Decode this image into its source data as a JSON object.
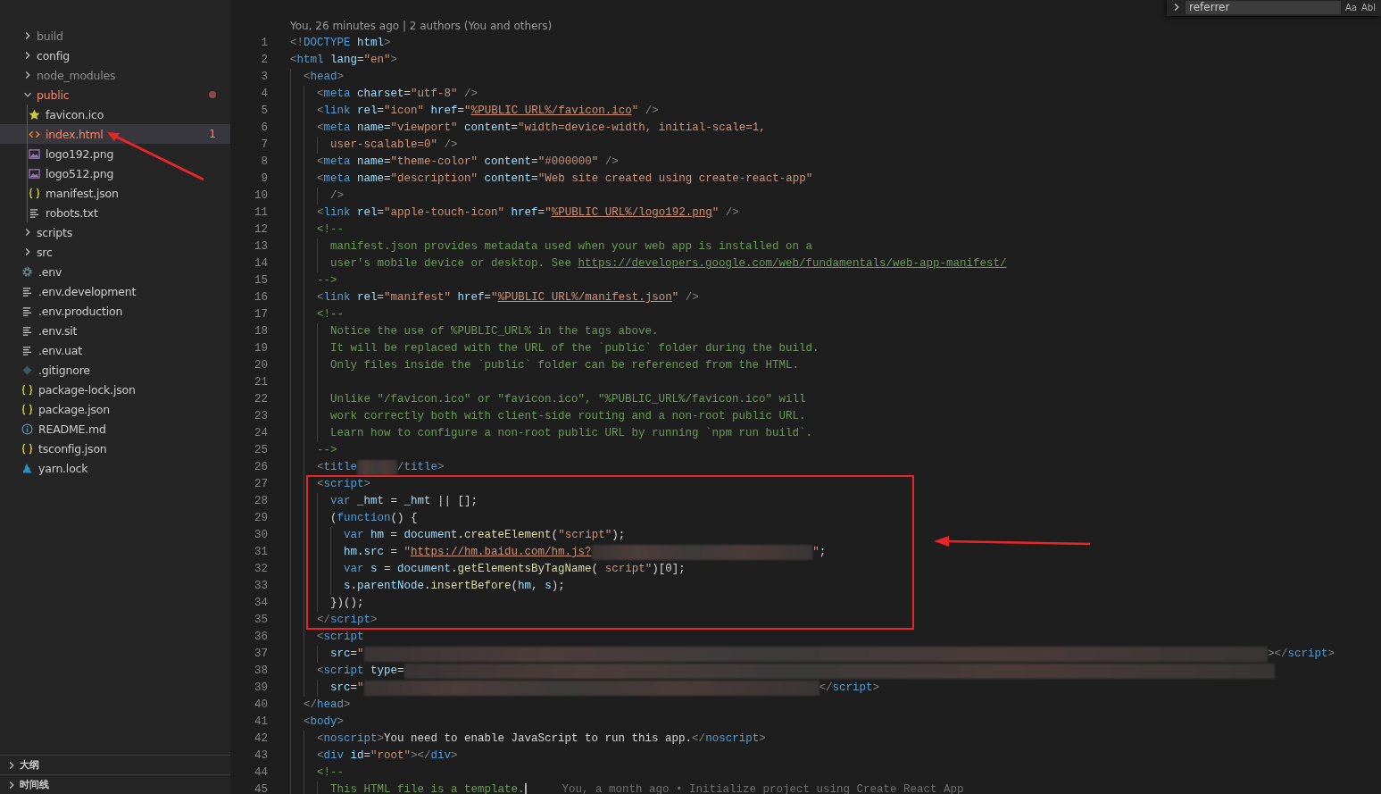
{
  "explorer": {
    "items": [
      {
        "kind": "folder",
        "name": "build",
        "expanded": false,
        "ignored": true,
        "modified": false
      },
      {
        "kind": "folder",
        "name": "config",
        "expanded": false,
        "ignored": false,
        "modified": false
      },
      {
        "kind": "folder",
        "name": "node_modules",
        "expanded": false,
        "ignored": true,
        "modified": false
      },
      {
        "kind": "folder",
        "name": "public",
        "expanded": true,
        "ignored": false,
        "modified": true,
        "children": [
          {
            "kind": "favicon",
            "name": "favicon.ico",
            "selected": false,
            "modified": false
          },
          {
            "kind": "html",
            "name": "index.html",
            "selected": true,
            "modified": true,
            "badge": "1",
            "arrow": true
          },
          {
            "kind": "image",
            "name": "logo192.png",
            "selected": false,
            "modified": false
          },
          {
            "kind": "image",
            "name": "logo512.png",
            "selected": false,
            "modified": false
          },
          {
            "kind": "json",
            "name": "manifest.json",
            "selected": false,
            "modified": false
          },
          {
            "kind": "text",
            "name": "robots.txt",
            "selected": false,
            "modified": false
          }
        ]
      },
      {
        "kind": "folder",
        "name": "scripts",
        "expanded": false,
        "ignored": false,
        "modified": false
      },
      {
        "kind": "folder",
        "name": "src",
        "expanded": false,
        "ignored": false,
        "modified": false
      },
      {
        "kind": "env",
        "name": ".env",
        "selected": false,
        "modified": false
      },
      {
        "kind": "text",
        "name": ".env.development",
        "selected": false,
        "modified": false
      },
      {
        "kind": "text",
        "name": ".env.production",
        "selected": false,
        "modified": false
      },
      {
        "kind": "text",
        "name": ".env.sit",
        "selected": false,
        "modified": false
      },
      {
        "kind": "text",
        "name": ".env.uat",
        "selected": false,
        "modified": false
      },
      {
        "kind": "gitignore",
        "name": ".gitignore",
        "selected": false,
        "modified": false
      },
      {
        "kind": "json",
        "name": "package-lock.json",
        "selected": false,
        "modified": false
      },
      {
        "kind": "json",
        "name": "package.json",
        "selected": false,
        "modified": false
      },
      {
        "kind": "markdown",
        "name": "README.md",
        "selected": false,
        "modified": false
      },
      {
        "kind": "json",
        "name": "tsconfig.json",
        "selected": false,
        "modified": false
      },
      {
        "kind": "yarn",
        "name": "yarn.lock",
        "selected": false,
        "modified": false
      }
    ]
  },
  "panels": [
    {
      "title": "大纲",
      "expanded": false
    },
    {
      "title": "时间线",
      "expanded": false
    }
  ],
  "find_widget": {
    "value": "referrer",
    "options": [
      "Aa",
      "Abl"
    ]
  },
  "editor": {
    "blame_header": "You, 26 minutes ago | 2 authors (You and others)",
    "blocks": [
      {
        "kind": "plain",
        "lines": [
          {
            "number": "1",
            "tokens": [
              {
                "kind": "punct",
                "text": "<!"
              },
              {
                "kind": "tag",
                "text": "DOCTYPE"
              },
              {
                "kind": "attr",
                "text": " html"
              },
              {
                "kind": "punct",
                "text": ">"
              }
            ]
          },
          {
            "number": "2",
            "tokens": [
              {
                "kind": "punct",
                "text": "<"
              },
              {
                "kind": "tag",
                "text": "html"
              },
              {
                "kind": "attr",
                "text": " lang"
              },
              {
                "kind": "text",
                "text": "="
              },
              {
                "kind": "string",
                "text": "\"en\""
              },
              {
                "kind": "punct",
                "text": ">"
              }
            ]
          },
          {
            "number": "3",
            "tokens": [
              {
                "kind": "indent"
              },
              {
                "kind": "punct",
                "text": "<"
              },
              {
                "kind": "tag",
                "text": "head"
              },
              {
                "kind": "punct",
                "text": ">"
              }
            ]
          },
          {
            "number": "4",
            "tokens": [
              {
                "kind": "indent"
              },
              {
                "kind": "indent"
              },
              {
                "kind": "punct",
                "text": "<"
              },
              {
                "kind": "tag",
                "text": "meta"
              },
              {
                "kind": "attr",
                "text": " charset"
              },
              {
                "kind": "text",
                "text": "="
              },
              {
                "kind": "string",
                "text": "\"utf-8\""
              },
              {
                "kind": "punct",
                "text": " />"
              }
            ]
          },
          {
            "number": "5",
            "tokens": [
              {
                "kind": "indent"
              },
              {
                "kind": "indent"
              },
              {
                "kind": "punct",
                "text": "<"
              },
              {
                "kind": "tag",
                "text": "link"
              },
              {
                "kind": "attr",
                "text": " rel"
              },
              {
                "kind": "text",
                "text": "="
              },
              {
                "kind": "string",
                "text": "\"icon\""
              },
              {
                "kind": "attr",
                "text": " href"
              },
              {
                "kind": "text",
                "text": "="
              },
              {
                "kind": "string",
                "text": "\""
              },
              {
                "kind": "string-link",
                "text": "%PUBLIC_URL%/favicon.ico"
              },
              {
                "kind": "string",
                "text": "\""
              },
              {
                "kind": "punct",
                "text": " />"
              }
            ]
          },
          {
            "number": "6",
            "tokens": [
              {
                "kind": "indent"
              },
              {
                "kind": "indent"
              },
              {
                "kind": "punct",
                "text": "<"
              },
              {
                "kind": "tag",
                "text": "meta"
              },
              {
                "kind": "attr",
                "text": " name"
              },
              {
                "kind": "text",
                "text": "="
              },
              {
                "kind": "string",
                "text": "\"viewport\""
              },
              {
                "kind": "attr",
                "text": " content"
              },
              {
                "kind": "text",
                "text": "="
              },
              {
                "kind": "string",
                "text": "\"width=device-width, initial-scale=1,"
              }
            ]
          },
          {
            "number": "7",
            "tokens": [
              {
                "kind": "indent"
              },
              {
                "kind": "indent"
              },
              {
                "kind": "indent"
              },
              {
                "kind": "string",
                "text": "user-scalable=0\""
              },
              {
                "kind": "punct",
                "text": " />"
              }
            ]
          },
          {
            "number": "8",
            "tokens": [
              {
                "kind": "indent"
              },
              {
                "kind": "indent"
              },
              {
                "kind": "punct",
                "text": "<"
              },
              {
                "kind": "tag",
                "text": "meta"
              },
              {
                "kind": "attr",
                "text": " name"
              },
              {
                "kind": "text",
                "text": "="
              },
              {
                "kind": "string",
                "text": "\"theme-color\""
              },
              {
                "kind": "attr",
                "text": " content"
              },
              {
                "kind": "text",
                "text": "="
              },
              {
                "kind": "string",
                "text": "\"#000000\""
              },
              {
                "kind": "punct",
                "text": " />"
              }
            ]
          },
          {
            "number": "9",
            "tokens": [
              {
                "kind": "indent"
              },
              {
                "kind": "indent"
              },
              {
                "kind": "punct",
                "text": "<"
              },
              {
                "kind": "tag",
                "text": "meta"
              },
              {
                "kind": "attr",
                "text": " name"
              },
              {
                "kind": "text",
                "text": "="
              },
              {
                "kind": "string",
                "text": "\"description\""
              },
              {
                "kind": "attr",
                "text": " content"
              },
              {
                "kind": "text",
                "text": "="
              },
              {
                "kind": "string",
                "text": "\"Web site created using create-react-app\""
              }
            ]
          },
          {
            "number": "10",
            "tokens": [
              {
                "kind": "indent"
              },
              {
                "kind": "indent"
              },
              {
                "kind": "indent"
              },
              {
                "kind": "punct",
                "text": "/>"
              }
            ]
          },
          {
            "number": "11",
            "tokens": [
              {
                "kind": "indent"
              },
              {
                "kind": "indent"
              },
              {
                "kind": "punct",
                "text": "<"
              },
              {
                "kind": "tag",
                "text": "link"
              },
              {
                "kind": "attr",
                "text": " rel"
              },
              {
                "kind": "text",
                "text": "="
              },
              {
                "kind": "string",
                "text": "\"apple-touch-icon\""
              },
              {
                "kind": "attr",
                "text": " href"
              },
              {
                "kind": "text",
                "text": "="
              },
              {
                "kind": "string",
                "text": "\""
              },
              {
                "kind": "string-link",
                "text": "%PUBLIC_URL%/logo192.png"
              },
              {
                "kind": "string",
                "text": "\""
              },
              {
                "kind": "punct",
                "text": " />"
              }
            ]
          },
          {
            "number": "12",
            "tokens": [
              {
                "kind": "indent"
              },
              {
                "kind": "indent"
              },
              {
                "kind": "comment",
                "text": "<!--"
              }
            ]
          },
          {
            "number": "13",
            "tokens": [
              {
                "kind": "indent"
              },
              {
                "kind": "indent"
              },
              {
                "kind": "indent"
              },
              {
                "kind": "comment",
                "text": "manifest.json provides metadata used when your web app is installed on a"
              }
            ]
          },
          {
            "number": "14",
            "tokens": [
              {
                "kind": "indent"
              },
              {
                "kind": "indent"
              },
              {
                "kind": "indent"
              },
              {
                "kind": "comment",
                "text": "user's mobile device or desktop. See"
              },
              {
                "kind": "comment-link",
                "text": "https://developers.google.com/web/fundamentals/web-app-manifest/"
              }
            ]
          },
          {
            "number": "15",
            "tokens": [
              {
                "kind": "indent"
              },
              {
                "kind": "indent"
              },
              {
                "kind": "comment",
                "text": "-->"
              }
            ]
          },
          {
            "number": "16",
            "tokens": [
              {
                "kind": "indent"
              },
              {
                "kind": "indent"
              },
              {
                "kind": "punct",
                "text": "<"
              },
              {
                "kind": "tag",
                "text": "link"
              },
              {
                "kind": "attr",
                "text": " rel"
              },
              {
                "kind": "text",
                "text": "="
              },
              {
                "kind": "string",
                "text": "\"manifest\""
              },
              {
                "kind": "attr",
                "text": " href"
              },
              {
                "kind": "text",
                "text": "="
              },
              {
                "kind": "string",
                "text": "\""
              },
              {
                "kind": "string-link",
                "text": "%PUBLIC_URL%/manifest.json"
              },
              {
                "kind": "string",
                "text": "\""
              },
              {
                "kind": "punct",
                "text": " />"
              }
            ]
          },
          {
            "number": "17",
            "tokens": [
              {
                "kind": "indent"
              },
              {
                "kind": "indent"
              },
              {
                "kind": "comment",
                "text": "<!--"
              }
            ]
          },
          {
            "number": "18",
            "tokens": [
              {
                "kind": "indent"
              },
              {
                "kind": "indent"
              },
              {
                "kind": "indent"
              },
              {
                "kind": "comment",
                "text": "Notice the use of %PUBLIC_URL% in the tags above."
              }
            ]
          },
          {
            "number": "19",
            "tokens": [
              {
                "kind": "indent"
              },
              {
                "kind": "indent"
              },
              {
                "kind": "indent"
              },
              {
                "kind": "comment",
                "text": "It will be replaced with the URL of the `public` folder during the build."
              }
            ]
          },
          {
            "number": "20",
            "tokens": [
              {
                "kind": "indent"
              },
              {
                "kind": "indent"
              },
              {
                "kind": "indent"
              },
              {
                "kind": "comment",
                "text": "Only files inside the `public` folder can be referenced from the HTML."
              }
            ]
          },
          {
            "number": "21",
            "tokens": [
              {
                "kind": "indent"
              },
              {
                "kind": "indent"
              },
              {
                "kind": "indent"
              }
            ]
          },
          {
            "number": "22",
            "tokens": [
              {
                "kind": "indent"
              },
              {
                "kind": "indent"
              },
              {
                "kind": "indent"
              },
              {
                "kind": "comment",
                "text": "Unlike \"/favicon.ico\" or \"favicon.ico\", \"%PUBLIC_URL%/favicon.ico\" will"
              }
            ]
          },
          {
            "number": "23",
            "tokens": [
              {
                "kind": "indent"
              },
              {
                "kind": "indent"
              },
              {
                "kind": "indent"
              },
              {
                "kind": "comment",
                "text": "work correctly both with client-side routing and a non-root public URL."
              }
            ]
          },
          {
            "number": "24",
            "tokens": [
              {
                "kind": "indent"
              },
              {
                "kind": "indent"
              },
              {
                "kind": "indent"
              },
              {
                "kind": "comment",
                "text": "Learn how to configure a non-root public URL by running `npm run build`."
              }
            ]
          },
          {
            "number": "25",
            "tokens": [
              {
                "kind": "indent"
              },
              {
                "kind": "indent"
              },
              {
                "kind": "comment",
                "text": "-->"
              }
            ]
          },
          {
            "number": "26",
            "tokens": [
              {
                "kind": "indent"
              },
              {
                "kind": "indent"
              },
              {
                "kind": "punct",
                "text": "<"
              },
              {
                "kind": "tag",
                "text": "title"
              },
              {
                "kind": "redacted"
              },
              {
                "kind": "punct",
                "text": "/"
              },
              {
                "kind": "tag",
                "text": "title"
              },
              {
                "kind": "punct",
                "text": ">"
              }
            ]
          }
        ]
      },
      {
        "kind": "highlight",
        "lines": [
          {
            "number": "27",
            "tokens": [
              {
                "kind": "indent"
              },
              {
                "kind": "indent"
              },
              {
                "kind": "punct",
                "text": "<"
              },
              {
                "kind": "tag",
                "text": "script"
              },
              {
                "kind": "punct",
                "text": ">"
              }
            ]
          },
          {
            "number": "28",
            "tokens": [
              {
                "kind": "indent"
              },
              {
                "kind": "indent"
              },
              {
                "kind": "indent"
              },
              {
                "kind": "keyword",
                "text": "var"
              },
              {
                "kind": "variable",
                "text": " _hmt"
              },
              {
                "kind": "text",
                "text": " = "
              },
              {
                "kind": "variable",
                "text": "_hmt"
              },
              {
                "kind": "text",
                "text": " || [];"
              }
            ]
          },
          {
            "number": "29",
            "tokens": [
              {
                "kind": "indent"
              },
              {
                "kind": "indent"
              },
              {
                "kind": "indent"
              },
              {
                "kind": "text",
                "text": "("
              },
              {
                "kind": "keyword",
                "text": "function"
              },
              {
                "kind": "text",
                "text": "() {"
              }
            ]
          },
          {
            "number": "30",
            "tokens": [
              {
                "kind": "indent"
              },
              {
                "kind": "indent"
              },
              {
                "kind": "indent"
              },
              {
                "kind": "indent"
              },
              {
                "kind": "keyword",
                "text": "var"
              },
              {
                "kind": "variable",
                "text": " hm"
              },
              {
                "kind": "text",
                "text": " = "
              },
              {
                "kind": "variable",
                "text": "document"
              },
              {
                "kind": "text",
                "text": "."
              },
              {
                "kind": "function",
                "text": "createElement"
              },
              {
                "kind": "text",
                "text": "("
              },
              {
                "kind": "string",
                "text": "\"script\""
              },
              {
                "kind": "text",
                "text": ");"
              }
            ]
          },
          {
            "number": "31",
            "tokens": [
              {
                "kind": "indent"
              },
              {
                "kind": "indent"
              },
              {
                "kind": "indent"
              },
              {
                "kind": "indent"
              },
              {
                "kind": "variable",
                "text": "hm"
              },
              {
                "kind": "text",
                "text": "."
              },
              {
                "kind": "variable",
                "text": "src"
              },
              {
                "kind": "text",
                "text": " = "
              },
              {
                "kind": "string",
                "text": "\""
              },
              {
                "kind": "string-link",
                "text": "https://hm.baidu.com/hm.js?"
              },
              {
                "kind": "redacted"
              },
              {
                "kind": "string",
                "text": "\""
              },
              {
                "kind": "text",
                "text": ";"
              }
            ]
          },
          {
            "number": "32",
            "tokens": [
              {
                "kind": "indent"
              },
              {
                "kind": "indent"
              },
              {
                "kind": "indent"
              },
              {
                "kind": "indent"
              },
              {
                "kind": "keyword",
                "text": "var"
              },
              {
                "kind": "variable",
                "text": " s"
              },
              {
                "kind": "text",
                "text": " = "
              },
              {
                "kind": "variable",
                "text": "document"
              },
              {
                "kind": "text",
                "text": "."
              },
              {
                "kind": "function",
                "text": "getElementsByTagName"
              },
              {
                "kind": "text",
                "text": "( "
              },
              {
                "kind": "string",
                "text": "script\""
              },
              {
                "kind": "text",
                "text": ")[0];"
              }
            ]
          },
          {
            "number": "33",
            "tokens": [
              {
                "kind": "indent"
              },
              {
                "kind": "indent"
              },
              {
                "kind": "indent"
              },
              {
                "kind": "indent"
              },
              {
                "kind": "variable",
                "text": "s"
              },
              {
                "kind": "text",
                "text": "."
              },
              {
                "kind": "variable",
                "text": "parentNode"
              },
              {
                "kind": "text",
                "text": "."
              },
              {
                "kind": "function",
                "text": "insertBefore"
              },
              {
                "kind": "text",
                "text": "("
              },
              {
                "kind": "variable",
                "text": "hm"
              },
              {
                "kind": "text",
                "text": ", "
              },
              {
                "kind": "variable",
                "text": "s"
              },
              {
                "kind": "text",
                "text": ");"
              }
            ]
          },
          {
            "number": "34",
            "tokens": [
              {
                "kind": "indent"
              },
              {
                "kind": "indent"
              },
              {
                "kind": "indent"
              },
              {
                "kind": "text",
                "text": "})();"
              }
            ]
          },
          {
            "number": "35",
            "tokens": [
              {
                "kind": "indent"
              },
              {
                "kind": "indent"
              },
              {
                "kind": "punct",
                "text": "</"
              },
              {
                "kind": "tag",
                "text": "script"
              },
              {
                "kind": "punct",
                "text": ">"
              }
            ]
          }
        ]
      },
      {
        "kind": "plain",
        "lines": [
          {
            "number": "36",
            "tokens": [
              {
                "kind": "indent"
              },
              {
                "kind": "indent"
              },
              {
                "kind": "punct",
                "text": "<"
              },
              {
                "kind": "tag",
                "text": "script"
              }
            ]
          },
          {
            "number": "37",
            "tokens": [
              {
                "kind": "indent"
              },
              {
                "kind": "indent"
              },
              {
                "kind": "indent"
              },
              {
                "kind": "attr",
                "text": "src"
              },
              {
                "kind": "text",
                "text": "="
              },
              {
                "kind": "string",
                "text": "\""
              },
              {
                "kind": "redacted"
              },
              {
                "kind": "punct",
                "text": "></"
              },
              {
                "kind": "tag",
                "text": "script"
              },
              {
                "kind": "punct",
                "text": ">"
              }
            ]
          },
          {
            "number": "38",
            "tokens": [
              {
                "kind": "indent"
              },
              {
                "kind": "indent"
              },
              {
                "kind": "punct",
                "text": "<"
              },
              {
                "kind": "tag",
                "text": "script"
              },
              {
                "kind": "attr",
                "text": " type"
              },
              {
                "kind": "text",
                "text": "="
              },
              {
                "kind": "redacted"
              }
            ]
          },
          {
            "number": "39",
            "tokens": [
              {
                "kind": "indent"
              },
              {
                "kind": "indent"
              },
              {
                "kind": "indent"
              },
              {
                "kind": "attr",
                "text": "src"
              },
              {
                "kind": "text",
                "text": "="
              },
              {
                "kind": "string",
                "text": "\""
              },
              {
                "kind": "redacted"
              },
              {
                "kind": "punct",
                "text": "</"
              },
              {
                "kind": "tag",
                "text": "script"
              },
              {
                "kind": "punct",
                "text": ">"
              }
            ]
          },
          {
            "number": "40",
            "tokens": [
              {
                "kind": "indent"
              },
              {
                "kind": "punct",
                "text": "</"
              },
              {
                "kind": "tag",
                "text": "head"
              },
              {
                "kind": "punct",
                "text": ">"
              }
            ]
          },
          {
            "number": "41",
            "tokens": [
              {
                "kind": "indent"
              },
              {
                "kind": "punct",
                "text": "<"
              },
              {
                "kind": "tag",
                "text": "body"
              },
              {
                "kind": "punct",
                "text": ">"
              }
            ]
          },
          {
            "number": "42",
            "tokens": [
              {
                "kind": "indent"
              },
              {
                "kind": "indent"
              },
              {
                "kind": "punct",
                "text": "<"
              },
              {
                "kind": "tag",
                "text": "noscript"
              },
              {
                "kind": "punct",
                "text": ">"
              },
              {
                "kind": "text",
                "text": "You need to enable JavaScript to run this app."
              },
              {
                "kind": "punct",
                "text": "</"
              },
              {
                "kind": "tag",
                "text": "noscript"
              },
              {
                "kind": "punct",
                "text": ">"
              }
            ]
          },
          {
            "number": "43",
            "tokens": [
              {
                "kind": "indent"
              },
              {
                "kind": "indent"
              },
              {
                "kind": "punct",
                "text": "<"
              },
              {
                "kind": "tag",
                "text": "div"
              },
              {
                "kind": "attr",
                "text": " id"
              },
              {
                "kind": "text",
                "text": "="
              },
              {
                "kind": "string",
                "text": "\"root\""
              },
              {
                "kind": "punct",
                "text": "></"
              },
              {
                "kind": "tag",
                "text": "div"
              },
              {
                "kind": "punct",
                "text": ">"
              }
            ]
          },
          {
            "number": "44",
            "tokens": [
              {
                "kind": "indent"
              },
              {
                "kind": "indent"
              },
              {
                "kind": "comment",
                "text": "<!--"
              }
            ]
          },
          {
            "number": "45",
            "cursor": true,
            "blame": "You, a month ago • Initialize project using Create React App",
            "tokens": [
              {
                "kind": "indent"
              },
              {
                "kind": "indent"
              },
              {
                "kind": "indent"
              },
              {
                "kind": "comment",
                "text": "This HTML file is a template."
              }
            ]
          }
        ]
      }
    ]
  }
}
